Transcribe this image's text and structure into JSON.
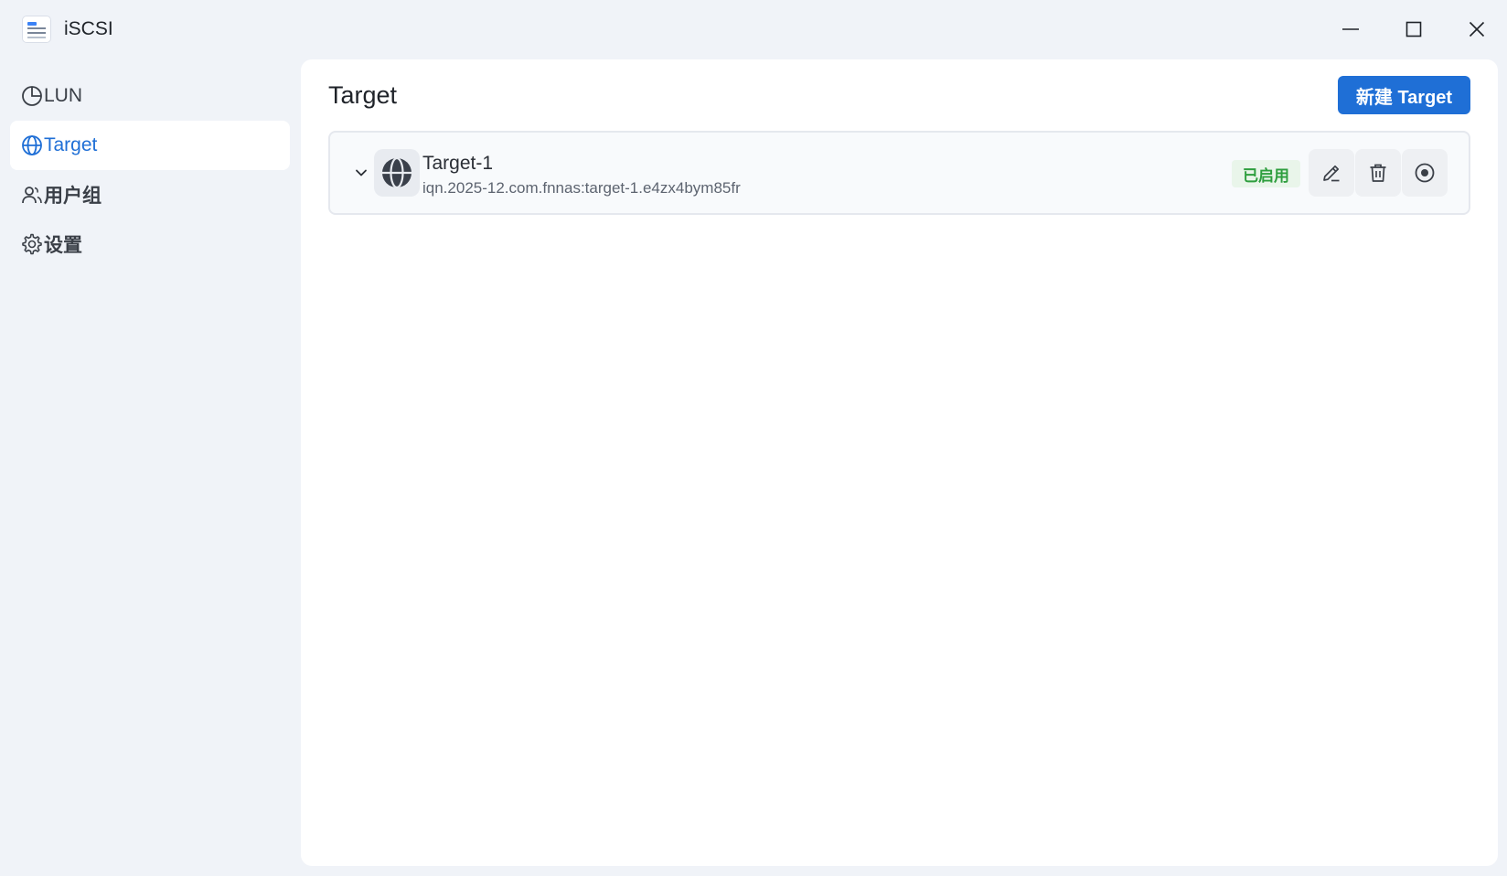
{
  "app": {
    "title": "iSCSI"
  },
  "window_controls": {
    "minimize": "minimize-icon",
    "maximize": "maximize-icon",
    "close": "close-icon"
  },
  "sidebar": {
    "items": [
      {
        "label": "LUN",
        "icon": "pie-chart-icon",
        "active": false
      },
      {
        "label": "Target",
        "icon": "globe-icon",
        "active": true
      },
      {
        "label": "用户组",
        "icon": "users-icon",
        "active": false
      },
      {
        "label": "设置",
        "icon": "gear-icon",
        "active": false
      }
    ]
  },
  "main": {
    "title": "Target",
    "new_button_label": "新建 Target",
    "targets": [
      {
        "name": "Target-1",
        "iqn": "iqn.2025-12.com.fnnas:target-1.e4zx4bym85fr",
        "status": "已启用",
        "actions": [
          "edit-icon",
          "delete-icon",
          "stop-icon"
        ]
      }
    ]
  },
  "colors": {
    "accent": "#1f6fd6",
    "status_enabled": "#2e9e3e",
    "background": "#f0f3f8"
  }
}
